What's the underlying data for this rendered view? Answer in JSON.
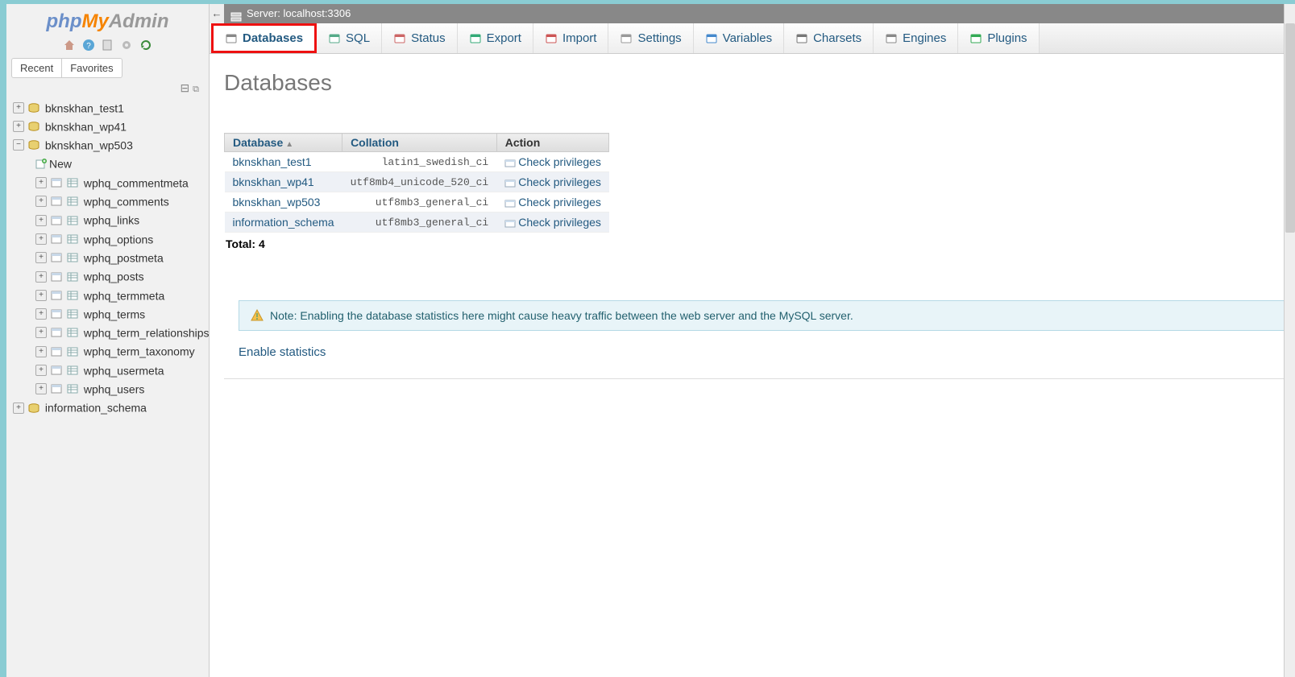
{
  "logo": {
    "p1": "php",
    "p2": "My",
    "p3": "Admin"
  },
  "recent_tabs": [
    "Recent",
    "Favorites"
  ],
  "tree": {
    "roots": [
      {
        "name": "bknskhan_test1",
        "expanded": false
      },
      {
        "name": "bknskhan_wp41",
        "expanded": false
      },
      {
        "name": "bknskhan_wp503",
        "expanded": true,
        "new_label": "New",
        "tables": [
          "wphq_commentmeta",
          "wphq_comments",
          "wphq_links",
          "wphq_options",
          "wphq_postmeta",
          "wphq_posts",
          "wphq_termmeta",
          "wphq_terms",
          "wphq_term_relationships",
          "wphq_term_taxonomy",
          "wphq_usermeta",
          "wphq_users"
        ]
      },
      {
        "name": "information_schema",
        "expanded": false
      }
    ]
  },
  "server_bar": "Server: localhost:3306",
  "nav": [
    {
      "label": "Databases",
      "color": "#888"
    },
    {
      "label": "SQL",
      "color": "#5a8"
    },
    {
      "label": "Status",
      "color": "#c66"
    },
    {
      "label": "Export",
      "color": "#3a7"
    },
    {
      "label": "Import",
      "color": "#c55"
    },
    {
      "label": "Settings",
      "color": "#999"
    },
    {
      "label": "Variables",
      "color": "#48c"
    },
    {
      "label": "Charsets",
      "color": "#777"
    },
    {
      "label": "Engines",
      "color": "#888"
    },
    {
      "label": "Plugins",
      "color": "#3a5"
    }
  ],
  "page_title": "Databases",
  "table": {
    "headers": {
      "db": "Database",
      "coll": "Collation",
      "action": "Action"
    },
    "rows": [
      {
        "name": "bknskhan_test1",
        "collation": "latin1_swedish_ci",
        "action": "Check privileges"
      },
      {
        "name": "bknskhan_wp41",
        "collation": "utf8mb4_unicode_520_ci",
        "action": "Check privileges"
      },
      {
        "name": "bknskhan_wp503",
        "collation": "utf8mb3_general_ci",
        "action": "Check privileges"
      },
      {
        "name": "information_schema",
        "collation": "utf8mb3_general_ci",
        "action": "Check privileges"
      }
    ],
    "total_label": "Total:",
    "total": "4"
  },
  "note": "Note: Enabling the database statistics here might cause heavy traffic between the web server and the MySQL server.",
  "enable_link": "Enable statistics"
}
